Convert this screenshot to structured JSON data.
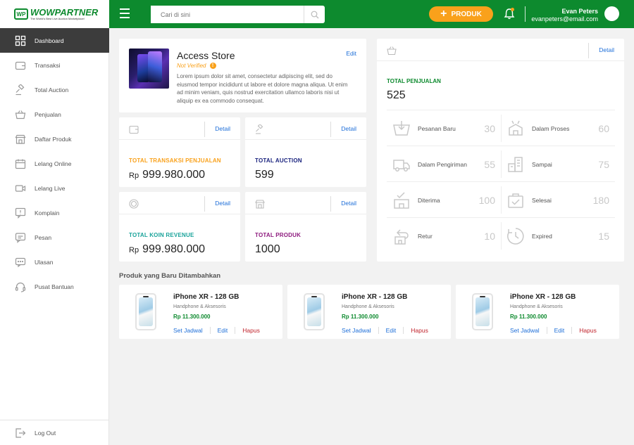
{
  "brand": {
    "logo_mark": "WP",
    "title": "WOWPARTNER",
    "tagline": "The World's Best Live Auction Marketplace!"
  },
  "header": {
    "search_placeholder": "Cari di sini",
    "add_product_label": "PRODUK",
    "user_name": "Evan Peters",
    "user_email": "evanpeters@email.com",
    "primary_color": "#0d8a2e",
    "accent_color": "#f9a11b"
  },
  "sidebar": {
    "items": [
      {
        "label": "Dashboard",
        "icon": "grid-icon"
      },
      {
        "label": "Transaksi",
        "icon": "wallet-icon"
      },
      {
        "label": "Total Auction",
        "icon": "gavel-icon"
      },
      {
        "label": "Penjualan",
        "icon": "basket-icon"
      },
      {
        "label": "Daftar Produk",
        "icon": "store-icon"
      },
      {
        "label": "Lelang Online",
        "icon": "calendar-icon"
      },
      {
        "label": "Lelang Live",
        "icon": "video-icon"
      },
      {
        "label": "Komplain",
        "icon": "alert-icon"
      },
      {
        "label": "Pesan",
        "icon": "message-icon"
      },
      {
        "label": "Ulasan",
        "icon": "comment-icon"
      },
      {
        "label": "Pusat Bantuan",
        "icon": "headset-icon"
      }
    ],
    "logout_label": "Log Out"
  },
  "store": {
    "name": "Access Store",
    "status": "Not Verified",
    "description": "Lorem ipsum dolor sit amet, consectetur adipiscing elit, sed do eiusmod tempor incididunt ut labore et dolore magna aliqua. Ut enim ad minim veniam, quis nostrud exercitation ullamco laboris nisi ut aliquip ex ea commodo consequat.",
    "edit_label": "Edit"
  },
  "stats": {
    "detail_label": "Detail",
    "transaksi": {
      "label": "TOTAL TRANSAKSI PENJUALAN",
      "currency": "Rp",
      "value": "999.980.000",
      "color": "#f9a11b"
    },
    "auction": {
      "label": "TOTAL AUCTION",
      "value": "599",
      "color": "#1a237e"
    },
    "koin": {
      "label": "TOTAL KOIN REVENUE",
      "currency": "Rp",
      "value": "999.980.000",
      "color": "#1aa39a"
    },
    "produk": {
      "label": "TOTAL PRODUK",
      "value": "1000",
      "color": "#8e1a7e"
    }
  },
  "penjualan": {
    "label": "TOTAL PENJUALAN",
    "value": "525",
    "items": [
      {
        "label": "Pesanan Baru",
        "value": "30",
        "icon": "cart-down-icon"
      },
      {
        "label": "Dalam Proses",
        "value": "60",
        "icon": "box-process-icon"
      },
      {
        "label": "Dalam Pengiriman",
        "value": "55",
        "icon": "truck-icon"
      },
      {
        "label": "Sampai",
        "value": "75",
        "icon": "building-icon"
      },
      {
        "label": "Diterima",
        "value": "100",
        "icon": "box-check-icon"
      },
      {
        "label": "Selesai",
        "value": "180",
        "icon": "bag-check-icon"
      },
      {
        "label": "Retur",
        "value": "10",
        "icon": "return-icon"
      },
      {
        "label": "Expired",
        "value": "15",
        "icon": "clock-icon"
      }
    ]
  },
  "recent": {
    "title": "Produk yang Baru Ditambahkan",
    "products": [
      {
        "name": "iPhone XR - 128 GB",
        "category": "Handphone & Aksesoris",
        "price": "Rp 11.300.000",
        "schedule_label": "Set Jadwal",
        "edit_label": "Edit",
        "delete_label": "Hapus"
      },
      {
        "name": "iPhone XR - 128 GB",
        "category": "Handphone & Aksesoris",
        "price": "Rp 11.300.000",
        "schedule_label": "Set Jadwal",
        "edit_label": "Edit",
        "delete_label": "Hapus"
      },
      {
        "name": "iPhone XR - 128 GB",
        "category": "Handphone & Aksesoris",
        "price": "Rp 11.300.000",
        "schedule_label": "Set Jadwal",
        "edit_label": "Edit",
        "delete_label": "Hapus"
      }
    ]
  }
}
